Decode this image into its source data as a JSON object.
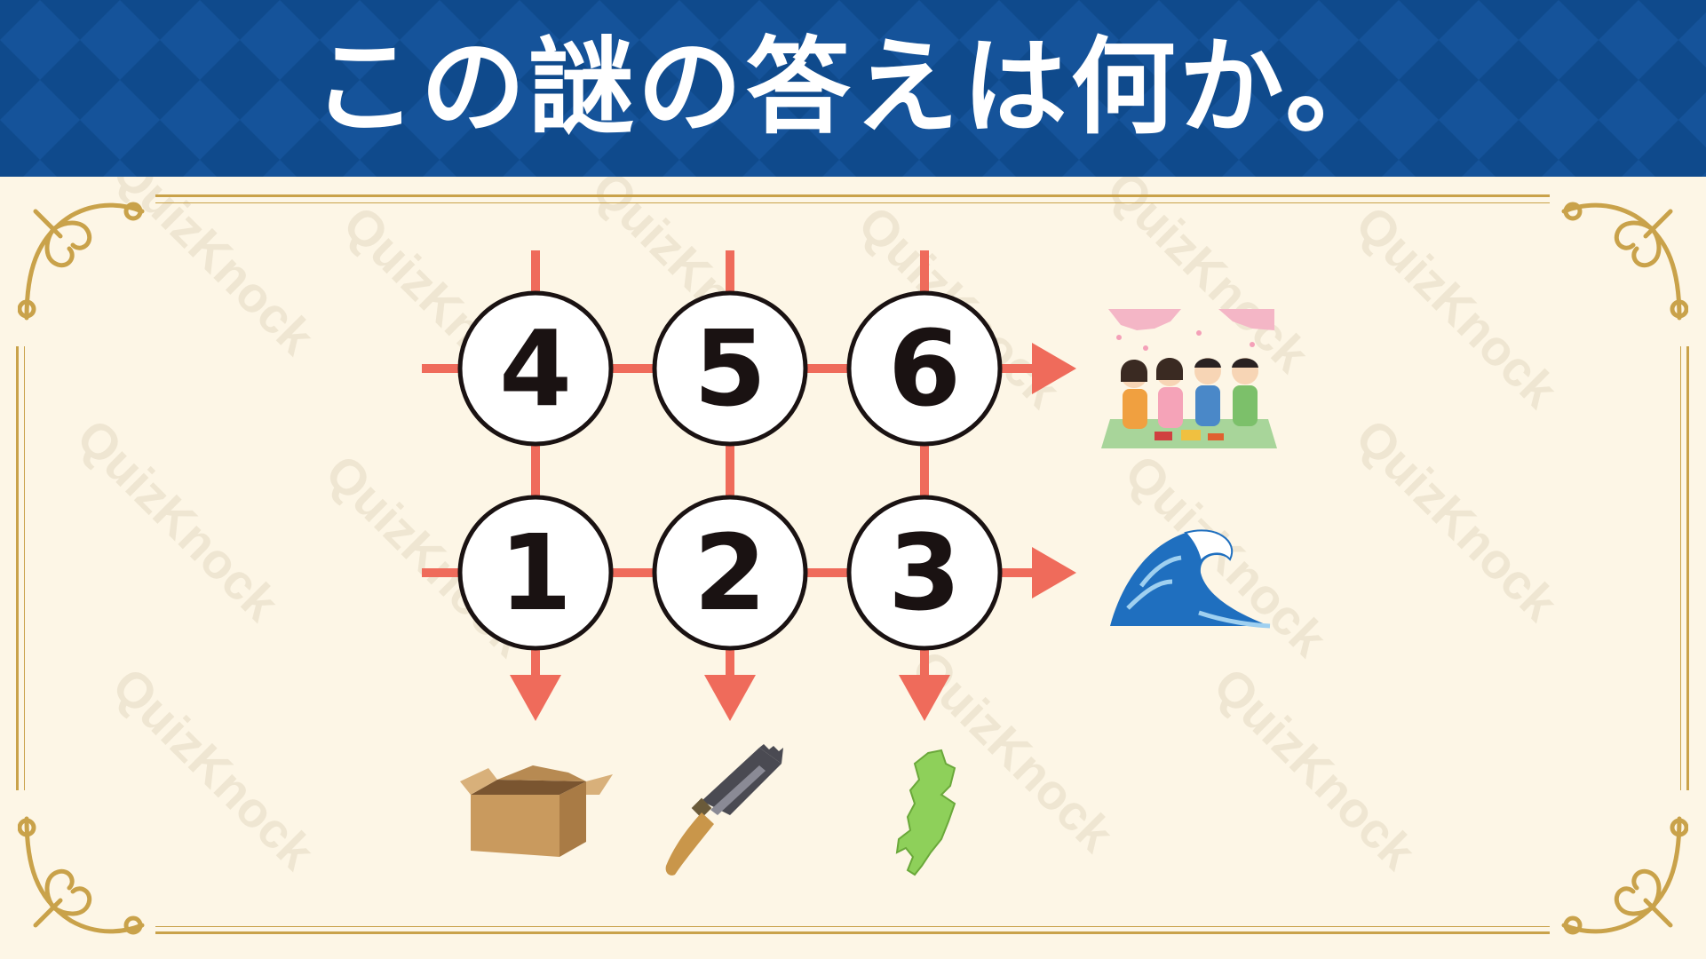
{
  "title": "この謎の答えは何か。",
  "watermark": "QuizKnock",
  "grid": {
    "top_row": [
      "4",
      "5",
      "6"
    ],
    "bottom_row": [
      "1",
      "2",
      "3"
    ]
  },
  "row_clues": [
    "hanami-party-illustration",
    "wave-illustration"
  ],
  "column_clues": [
    "cardboard-box-illustration",
    "saw-knife-illustration",
    "mie-prefecture-map-illustration"
  ],
  "colors": {
    "header": "#0f4a8c",
    "background": "#fdf6e6",
    "arrow": "#ef6b5b",
    "frame": "#c9a24a"
  }
}
